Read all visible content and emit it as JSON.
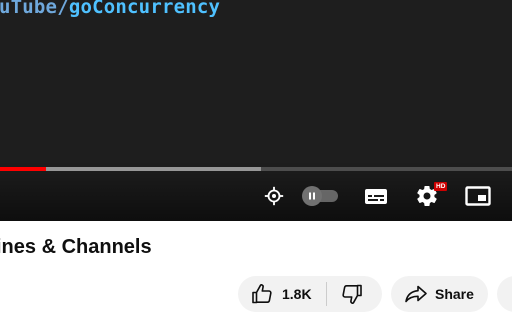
{
  "player": {
    "code_text_prefix": "uTube/",
    "code_text_highlight": "goConcurrency",
    "progress": {
      "played_fraction": 0.09,
      "buffered_fraction": 0.51
    },
    "controls": {
      "autoplay_on": false,
      "hd_badge": "HD"
    },
    "icons": [
      "miniplayer-target-icon",
      "autoplay-toggle",
      "subtitles-icon",
      "settings-gear-icon",
      "picture-in-picture-icon"
    ]
  },
  "video": {
    "title": "ines & Channels"
  },
  "actions": {
    "like_count": "1.8K",
    "share_label": "Share"
  },
  "colors": {
    "progress_played": "#ff0000",
    "hd_badge": "#cc0000",
    "button_bg": "#f2f2f2"
  }
}
